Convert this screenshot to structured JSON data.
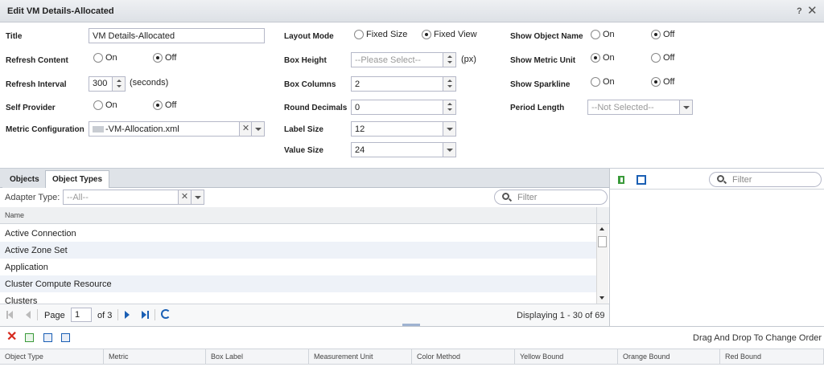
{
  "window": {
    "title": "Edit VM Details-Allocated",
    "help": "?",
    "close": "✕"
  },
  "form": {
    "title_label": "Title",
    "title_value": "VM Details-Allocated",
    "refresh_content_label": "Refresh Content",
    "refresh_interval_label": "Refresh Interval",
    "refresh_interval_value": "300",
    "refresh_interval_unit": "(seconds)",
    "self_provider_label": "Self Provider",
    "metric_config_label": "Metric Configuration",
    "metric_config_value": "-VM-Allocation.xml",
    "on_label": "On",
    "off_label": "Off",
    "layout_mode_label": "Layout Mode",
    "layout_fixed_size": "Fixed Size",
    "layout_fixed_view": "Fixed View",
    "box_height_label": "Box Height",
    "box_height_placeholder": "--Please Select--",
    "box_height_unit": "(px)",
    "box_columns_label": "Box Columns",
    "box_columns_value": "2",
    "round_decimals_label": "Round Decimals",
    "round_decimals_value": "0",
    "label_size_label": "Label Size",
    "label_size_value": "12",
    "value_size_label": "Value Size",
    "value_size_value": "24",
    "show_object_name_label": "Show Object Name",
    "show_metric_unit_label": "Show Metric Unit",
    "show_sparkline_label": "Show Sparkline",
    "period_length_label": "Period Length",
    "period_length_placeholder": "--Not Selected--"
  },
  "objects_panel": {
    "tabs": [
      "Objects",
      "Object Types"
    ],
    "active_tab": "Object Types",
    "adapter_type_label": "Adapter Type:",
    "adapter_type_placeholder": "--All--",
    "filter_placeholder": "Filter",
    "column_name": "Name",
    "rows": [
      "Active Connection",
      "Active Zone Set",
      "Application",
      "Cluster Compute Resource",
      "Clusters"
    ],
    "pager": {
      "page_label": "Page",
      "page_value": "1",
      "of_label": "of 3",
      "displaying": "Displaying 1 - 30 of 69"
    }
  },
  "right_panel": {
    "filter_placeholder": "Filter"
  },
  "bottom": {
    "drag_hint": "Drag And Drop To Change Order",
    "columns": [
      "Object Type",
      "Metric",
      "Box Label",
      "Measurement Unit",
      "Color Method",
      "Yellow Bound",
      "Orange Bound",
      "Red Bound"
    ]
  },
  "colors": {
    "accent": "#1a5fb4",
    "delete": "#d62a1e",
    "green": "#3a9a3a"
  }
}
